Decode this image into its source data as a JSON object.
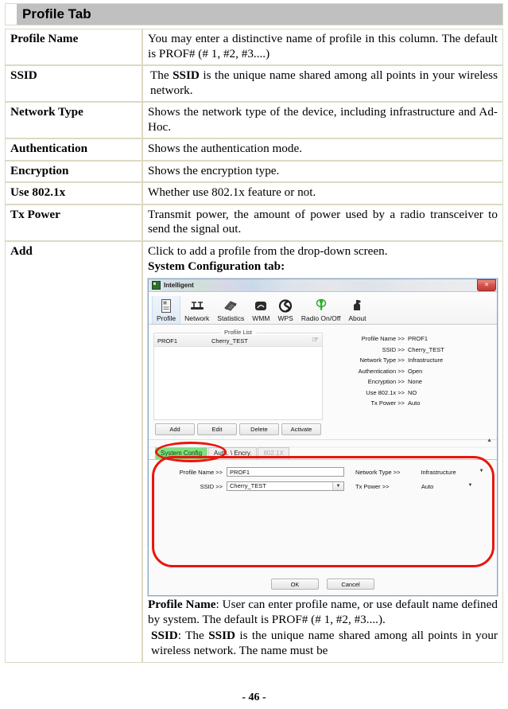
{
  "header": {
    "title": "Profile Tab"
  },
  "table": {
    "rows": [
      {
        "key": "Profile Name",
        "value": "You may enter a distinctive name of profile in this column. The default is PROF# (# 1, #2, #3....)"
      },
      {
        "key": "SSID",
        "value_pre": "The ",
        "value_bold": "SSID",
        "value_post": " is the unique name shared among all points in your wireless network."
      },
      {
        "key": "Network Type",
        "value": "Shows the network type of the device, including infrastructure and Ad-Hoc."
      },
      {
        "key": "Authentication",
        "value": "Shows the authentication mode."
      },
      {
        "key": "Encryption",
        "value": "Shows the encryption type."
      },
      {
        "key": "Use 802.1x",
        "value": "Whether use 802.1x feature or not."
      },
      {
        "key": "Tx Power",
        "value": "Transmit power, the amount of power used by a radio transceiver to send the signal out."
      }
    ],
    "add_row": {
      "key": "Add",
      "intro": "Click to add a profile from the drop-down screen.",
      "subtitle": "System Configuration tab:",
      "para1_bold": "Profile Name",
      "para1_rest": ": User can enter profile name, or use default name defined by system. The default is PROF# (# 1, #2, #3....).",
      "para2_bold": "SSID",
      "para2_mid": ": The ",
      "para2_bold2": "SSID",
      "para2_rest": " is the unique name shared among all points in your wireless network. The name must be"
    }
  },
  "utility": {
    "window_title": "Intelligent",
    "close_label": "✕",
    "toolbar": [
      {
        "label": "Profile",
        "icon": "profile-icon",
        "active": true
      },
      {
        "label": "Network",
        "icon": "network-icon",
        "active": false
      },
      {
        "label": "Statistics",
        "icon": "statistics-icon",
        "active": false
      },
      {
        "label": "WMM",
        "icon": "wmm-icon",
        "active": false
      },
      {
        "label": "WPS",
        "icon": "wps-icon",
        "active": false
      },
      {
        "label": "Radio On/Off",
        "icon": "radio-onoff-icon",
        "active": false
      },
      {
        "label": "About",
        "icon": "about-icon",
        "active": false
      }
    ],
    "profile_list": {
      "legend": "Profile List",
      "rows": [
        {
          "name": "PROF1",
          "ssid": "Cherry_TEST",
          "hand": "☞"
        }
      ],
      "buttons": [
        "Add",
        "Edit",
        "Delete",
        "Activate"
      ]
    },
    "info": [
      {
        "label": "Profile Name >>",
        "value": "PROF1"
      },
      {
        "label": "SSID >>",
        "value": "Cherry_TEST"
      },
      {
        "label": "Network Type >>",
        "value": "Infrastructure"
      },
      {
        "label": "Authentication >>",
        "value": "Open"
      },
      {
        "label": "Encryption >>",
        "value": "None"
      },
      {
        "label": "Use 802.1x >>",
        "value": "NO"
      },
      {
        "label": "Tx Power >>",
        "value": "Auto"
      }
    ],
    "tabs": [
      {
        "label": "System Config",
        "state": "green"
      },
      {
        "label": "Auth. \\ Encry.",
        "state": "normal"
      },
      {
        "label": "802.1X",
        "state": "dim"
      }
    ],
    "form": {
      "profile_name_label": "Profile Name >>",
      "profile_name_value": "PROF1",
      "ssid_label": "SSID >>",
      "ssid_value": "Cherry_TEST",
      "network_type_label": "Network Type >>",
      "network_type_value": "Infrastructure",
      "tx_power_label": "Tx Power >>",
      "tx_power_value": "Auto",
      "arrow": "▼"
    },
    "actions": {
      "ok": "OK",
      "cancel": "Cancel"
    },
    "annotation_color": "#e8160f"
  },
  "footer": {
    "page": "- 46 -"
  }
}
